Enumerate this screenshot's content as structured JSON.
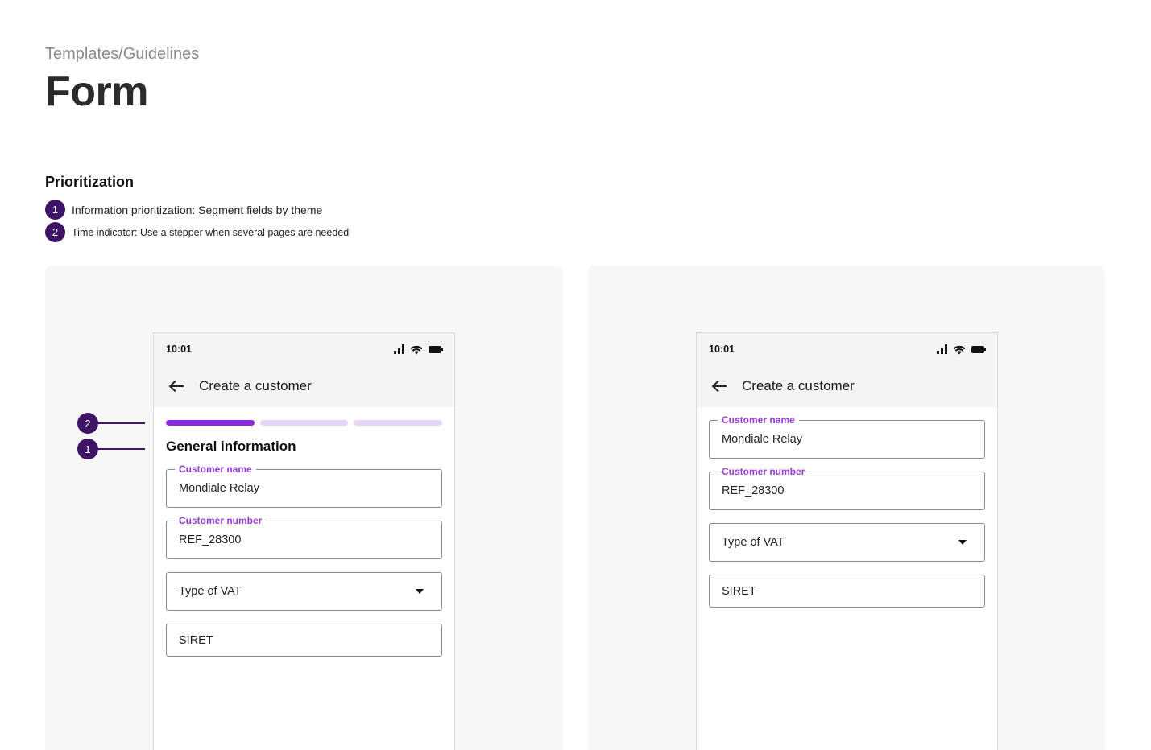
{
  "header": {
    "breadcrumb": "Templates/Guidelines",
    "title": "Form"
  },
  "prioritization": {
    "title": "Prioritization",
    "items": [
      {
        "number": "1",
        "text": "Information prioritization: Segment fields by theme"
      },
      {
        "number": "2",
        "text": "Time indicator: Use a stepper when several pages are needed"
      }
    ]
  },
  "callouts": [
    {
      "number": "2"
    },
    {
      "number": "1"
    }
  ],
  "mockups": [
    {
      "status_time": "10:01",
      "app_title": "Create a customer",
      "stepper": {
        "total_steps": 3,
        "current_step": 1
      },
      "group_title": "General information",
      "fields": {
        "customer_name": {
          "label": "Customer name",
          "value": "Mondiale Relay"
        },
        "customer_number": {
          "label": "Customer number",
          "value": "REF_28300"
        },
        "vat": {
          "placeholder": "Type of VAT"
        },
        "siret": {
          "placeholder": "SIRET"
        }
      }
    },
    {
      "status_time": "10:01",
      "app_title": "Create a customer",
      "fields": {
        "customer_name": {
          "label": "Customer name",
          "value": "Mondiale Relay"
        },
        "customer_number": {
          "label": "Customer number",
          "value": "REF_28300"
        },
        "vat": {
          "placeholder": "Type of VAT"
        },
        "siret": {
          "placeholder": "SIRET"
        }
      }
    }
  ],
  "icons": {
    "back": "arrow-left-icon",
    "signal": "signal-icon",
    "wifi": "wifi-icon",
    "battery": "battery-icon",
    "dropdown": "caret-down-icon"
  },
  "colors": {
    "accent": "#8a2be2",
    "accent_light": "#e6d6f7",
    "label": "#9b3bd6",
    "badge": "#3d1466",
    "panel_bg": "#f7f7f7"
  }
}
